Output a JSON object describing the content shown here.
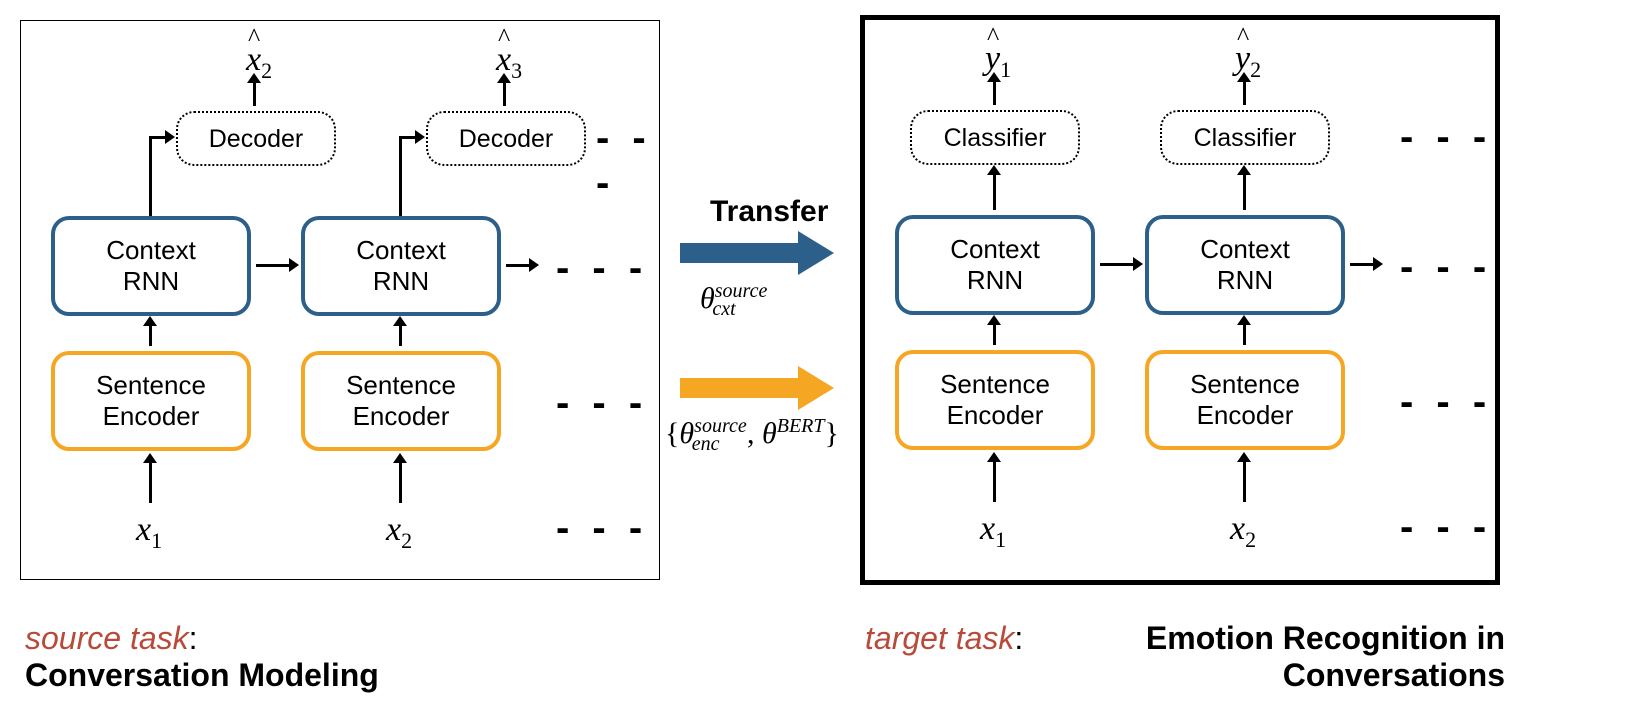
{
  "left": {
    "encoder": "Sentence\nEncoder",
    "context": "Context\nRNN",
    "decoder": "Decoder",
    "x1": "x",
    "x1_sub": "1",
    "x2": "x",
    "x2_sub": "2",
    "xhat2": "x",
    "xhat2_sub": "2",
    "xhat3": "x",
    "xhat3_sub": "3"
  },
  "right": {
    "encoder": "Sentence\nEncoder",
    "context": "Context\nRNN",
    "classifier": "Classifier",
    "x1": "x",
    "x1_sub": "1",
    "x2": "x",
    "x2_sub": "2",
    "yhat1": "y",
    "yhat1_sub": "1",
    "yhat2": "y",
    "yhat2_sub": "2"
  },
  "transfer": {
    "label": "Transfer",
    "theta_cxt_base": "θ",
    "theta_cxt_sub": "cxt",
    "theta_cxt_sup": "source",
    "set_open": "{",
    "theta_enc_base": "θ",
    "theta_enc_sub": "enc",
    "theta_enc_sup": "source",
    "sep": " , ",
    "theta_bert_base": "θ",
    "theta_bert_sup": "BERT",
    "set_close": "}"
  },
  "captions": {
    "source_label": "source task",
    "source_colon": ":",
    "source_name": "Conversation Modeling",
    "target_label": "target task",
    "target_colon": ":",
    "target_name_l1": "Emotion Recognition in",
    "target_name_l2": "Conversations"
  },
  "dashes": "- - -"
}
